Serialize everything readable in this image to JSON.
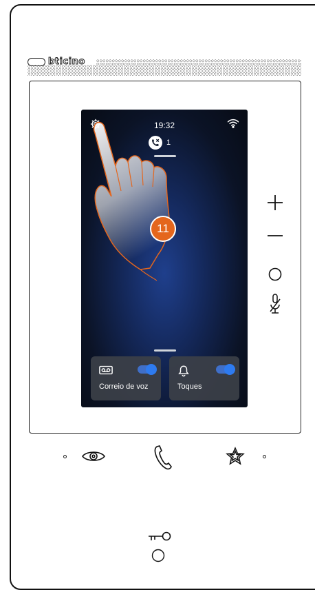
{
  "brand": {
    "name": "bticino"
  },
  "screen": {
    "time": "19:32",
    "missed_calls": {
      "count": "1"
    },
    "step_badge": "11",
    "tiles": [
      {
        "label": "Correio de voz",
        "icon": "voicemail-icon",
        "toggle_on": true
      },
      {
        "label": "Toques",
        "icon": "bell-icon",
        "toggle_on": true
      }
    ]
  },
  "side_buttons": [
    "plus-icon",
    "minus-icon",
    "circle-icon",
    "mic-mute-icon"
  ],
  "bottom_buttons": [
    "eye-icon",
    "handset-icon",
    "star-icon"
  ],
  "door_button": "key-icon",
  "colors": {
    "accent_orange": "#e4661d",
    "toggle_blue": "#2e7bf0",
    "screen_bg": "#0b1326"
  }
}
